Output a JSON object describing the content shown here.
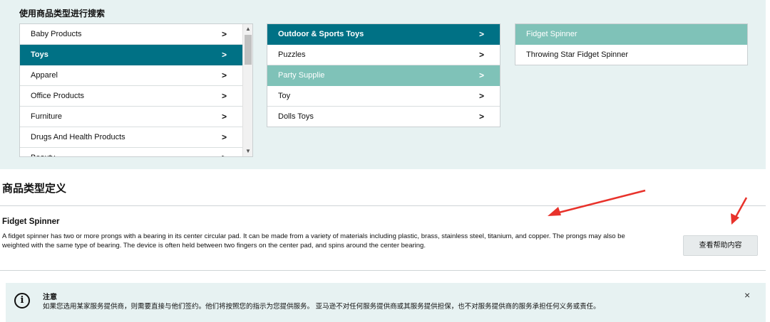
{
  "search_title": "使用商品类型进行搜索",
  "col1": [
    {
      "label": "Baby Products",
      "state": "normal"
    },
    {
      "label": "Toys",
      "state": "selected"
    },
    {
      "label": "Apparel",
      "state": "normal"
    },
    {
      "label": "Office Products",
      "state": "normal"
    },
    {
      "label": "Furniture",
      "state": "normal"
    },
    {
      "label": "Drugs And Health Products",
      "state": "normal"
    },
    {
      "label": "Beauty",
      "state": "cut"
    }
  ],
  "col2": [
    {
      "label": "Outdoor & Sports Toys",
      "state": "selected"
    },
    {
      "label": "Puzzles",
      "state": "normal"
    },
    {
      "label": "Party Supplie",
      "state": "light"
    },
    {
      "label": "Toy",
      "state": "normal"
    },
    {
      "label": "Dolls Toys",
      "state": "normal"
    }
  ],
  "col3": [
    {
      "label": "Fidget Spinner",
      "state": "light"
    },
    {
      "label": "Throwing Star Fidget Spinner",
      "state": "normal"
    }
  ],
  "chevron": ">",
  "definition": {
    "section_title": "商品类型定义",
    "name": "Fidget Spinner",
    "description": "A fidget spinner has two or more prongs with a bearing in its center circular pad. It can be made from a variety of materials including plastic, brass, stainless steel, titanium, and copper. The prongs may also be weighted with the same type of bearing. The device is often held between two fingers on the center pad, and spins around the center bearing.",
    "help_button": "查看帮助内容"
  },
  "notice": {
    "icon": "i",
    "title": "注意",
    "text": "如果您选用某家服务提供商，则需要直接与他们签约。他们将按照您的指示为您提供服务。 亚马逊不对任何服务提供商或其服务提供担保，也不对服务提供商的服务承担任何义务或责任。",
    "close": "×"
  },
  "colors": {
    "selected": "#007185",
    "light": "#7fc2b8",
    "panel_bg": "#e7f2f2",
    "arrow": "#e8322b"
  }
}
